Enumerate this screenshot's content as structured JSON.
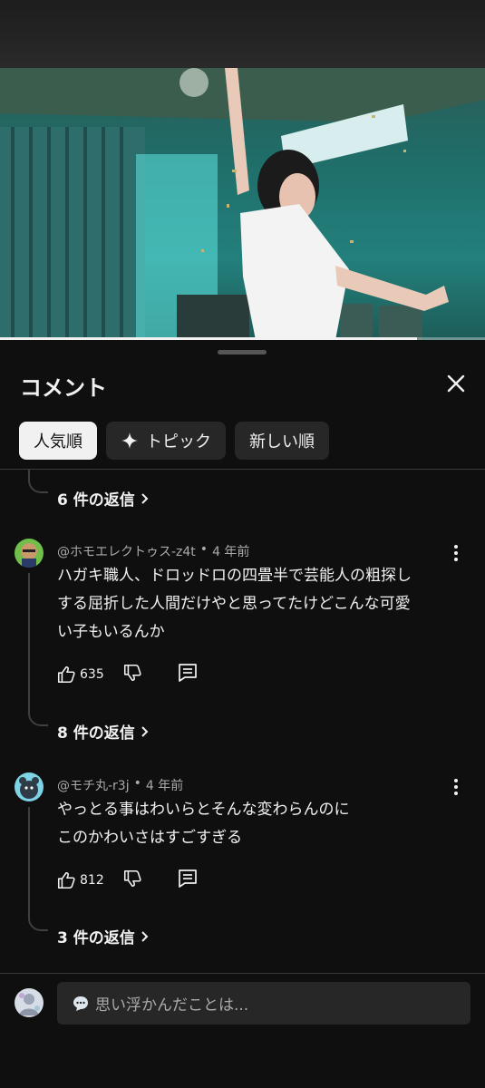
{
  "video": {
    "progress_fraction": 0.86
  },
  "sheet": {
    "title": "コメント",
    "chips": [
      {
        "label": "人気順",
        "active": true
      },
      {
        "label": "トピック",
        "icon": "sparkle-icon"
      },
      {
        "label": "新しい順"
      }
    ]
  },
  "threads": [
    {
      "replies_label": "6 件の返信"
    },
    {
      "author": "@ホモエレクトゥス-z4t",
      "time": "4 年前",
      "lines": [
        "ハガキ職人、ドロッドロの四畳半で芸能人の粗探し",
        "する屈折した人間だけやと思ってたけどこんな可愛",
        "い子もいるんか"
      ],
      "likes": "635",
      "replies_label": "8 件の返信"
    },
    {
      "author": "@モチ丸-r3j",
      "time": "4 年前",
      "lines": [
        "やっとる事はわいらとそんな変わらんのに",
        "このかわいさはすごすぎる"
      ],
      "likes": "812",
      "replies_label": "3 件の返信"
    }
  ],
  "input": {
    "placeholder": "思い浮かんだことは..."
  },
  "colors": {
    "background": "#0f0f0f",
    "chip": "#272727",
    "active_chip": "#f1f1f1",
    "secondary_text": "#aaaaaa"
  }
}
